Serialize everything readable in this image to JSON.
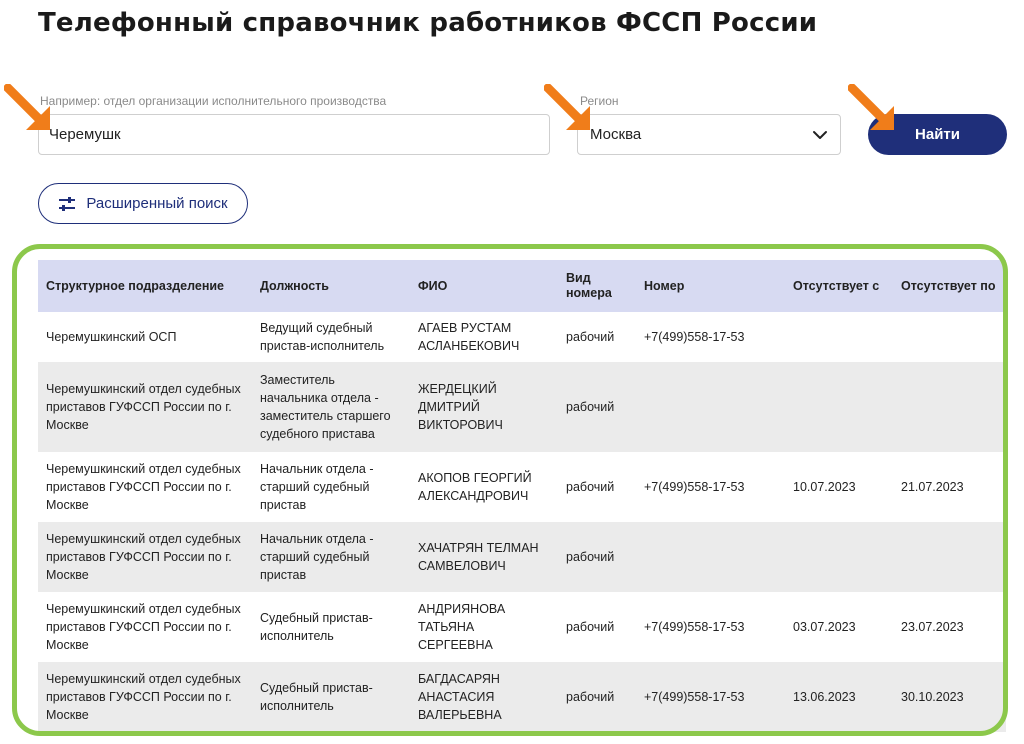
{
  "page_title": "Телефонный справочник работников ФССП России",
  "search": {
    "query_placeholder": "Например: отдел организации исполнительного производства",
    "query_value": "Черемушк",
    "region_label": "Регион",
    "region_value": "Москва",
    "find_label": "Найти",
    "advanced_label": "Расширенный поиск"
  },
  "table": {
    "columns": [
      "Структурное подразделение",
      "Должность",
      "ФИО",
      "Вид номера",
      "Номер",
      "Отсутствует с",
      "Отсутствует по"
    ],
    "rows": [
      [
        "Черемушкинский ОСП",
        "Ведущий судебный пристав-исполнитель",
        "АГАЕВ РУСТАМ АСЛАНБЕКОВИЧ",
        "рабочий",
        "+7(499)558-17-53",
        "",
        ""
      ],
      [
        "Черемушкинский отдел судебных приставов ГУФССП России по г. Москве",
        "Заместитель начальника отдела - заместитель старшего судебного пристава",
        "ЖЕРДЕЦКИЙ ДМИТРИЙ ВИКТОРОВИЧ",
        "рабочий",
        "",
        "",
        ""
      ],
      [
        "Черемушкинский отдел судебных приставов ГУФССП России по г. Москве",
        "Начальник отдела - старший судебный пристав",
        "АКОПОВ ГЕОРГИЙ АЛЕКСАНДРОВИЧ",
        "рабочий",
        "+7(499)558-17-53",
        "10.07.2023",
        "21.07.2023"
      ],
      [
        "Черемушкинский отдел судебных приставов ГУФССП России по г. Москве",
        "Начальник отдела - старший судебный пристав",
        "ХАЧАТРЯН ТЕЛМАН САМВЕЛОВИЧ",
        "рабочий",
        "",
        "",
        ""
      ],
      [
        "Черемушкинский отдел судебных приставов ГУФССП России по г. Москве",
        "Судебный пристав-исполнитель",
        "АНДРИЯНОВА ТАТЬЯНА СЕРГЕЕВНА",
        "рабочий",
        "+7(499)558-17-53",
        "03.07.2023",
        "23.07.2023"
      ],
      [
        "Черемушкинский отдел судебных приставов ГУФССП России по г. Москве",
        "Судебный пристав-исполнитель",
        "БАГДАСАРЯН АНАСТАСИЯ ВАЛЕРЬЕВНА",
        "рабочий",
        "+7(499)558-17-53",
        "13.06.2023",
        "30.10.2023"
      ]
    ]
  },
  "colors": {
    "accent": "#1f2f7a",
    "header_bg": "#d7daf2",
    "highlight_frame": "#8cc84b",
    "annotation_arrow": "#f07d1a"
  },
  "icons": {
    "annotation": "orange-arrow-icon",
    "select": "chevron-down-icon",
    "advanced": "sliders-icon"
  }
}
